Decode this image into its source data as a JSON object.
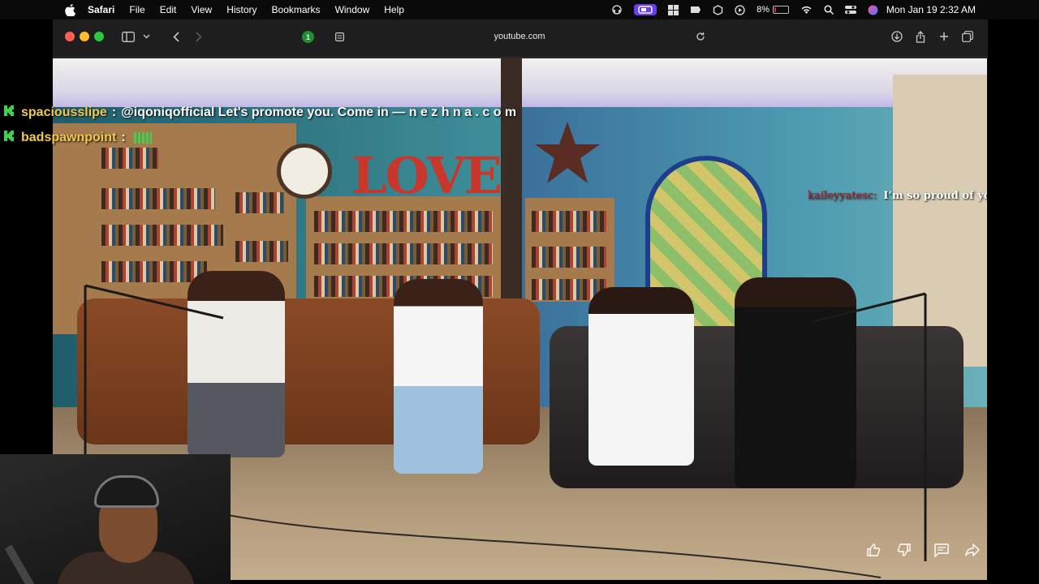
{
  "menubar": {
    "app_name": "Safari",
    "menus": [
      "File",
      "Edit",
      "View",
      "History",
      "Bookmarks",
      "Window",
      "Help"
    ],
    "battery_percent": "8%",
    "battery_level": 0.08,
    "clock": "Mon Jan 19  2:32 AM"
  },
  "browser": {
    "url": "youtube.com",
    "shield_count": "1"
  },
  "video": {
    "set_sign": "LOVE",
    "chat": [
      {
        "user": "spaciousslipe",
        "separator": ":",
        "message": "@iqoniqofficial Let's promote you. Come in — n e z h n a . c o m"
      },
      {
        "user": "badspawnpoint",
        "separator": ":",
        "message": ""
      }
    ],
    "caption": {
      "user": "kaileyyatesc:",
      "text": "I’m so proud of you"
    },
    "colors": {
      "chat_user": "#f2c94c",
      "chat_badge": "#3ad34a",
      "caption_user": "#b3131f"
    }
  }
}
